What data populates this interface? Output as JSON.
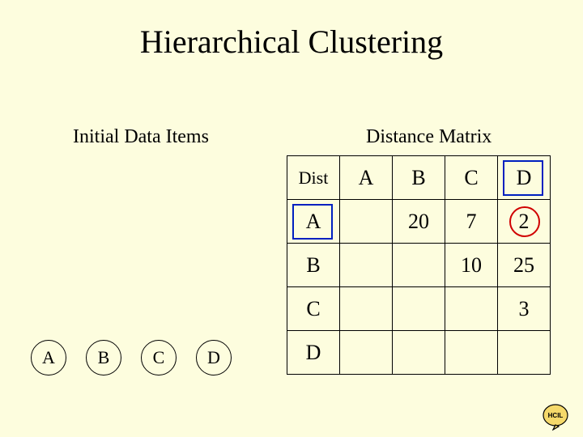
{
  "title": "Hierarchical Clustering",
  "left_subtitle": "Initial Data Items",
  "right_subtitle": "Distance Matrix",
  "items": [
    "A",
    "B",
    "C",
    "D"
  ],
  "matrix": {
    "corner": "Dist",
    "cols": [
      "A",
      "B",
      "C",
      "D"
    ],
    "rows": [
      "A",
      "B",
      "C",
      "D"
    ],
    "cells": {
      "A_B": 20,
      "A_C": 7,
      "A_D": 2,
      "B_C": 10,
      "B_D": 25,
      "C_D": 3
    }
  },
  "highlights": {
    "min_pair": "A_D",
    "col_header_boxed": "D",
    "row_header_boxed": "A"
  },
  "logo_text": "HCIL"
}
